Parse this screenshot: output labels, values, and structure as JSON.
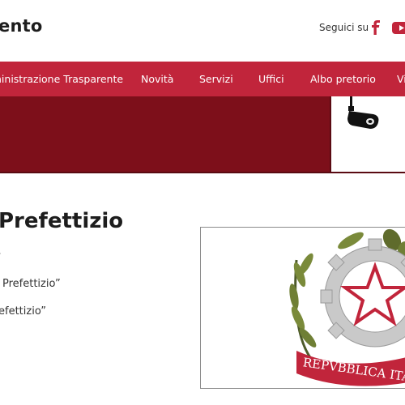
{
  "header": {
    "site_title": "ento",
    "social_label": "Seguici su",
    "icons": [
      "facebook-icon",
      "youtube-icon"
    ]
  },
  "nav": {
    "items": [
      "ninistrazione Trasparente",
      "Novità",
      "Servizi",
      "Uffici",
      "Albo pretorio",
      "Vi"
    ]
  },
  "banner": {
    "icon": "camera-icon"
  },
  "content": {
    "title": "Prefettizio",
    "dash": "-",
    "line1": "Prefettizio”",
    "line2": "efettizio”"
  },
  "emblem": {
    "ribbon_text": "REPVBBLICA ITA"
  },
  "colors": {
    "nav_bg": "#c1253b",
    "banner_bg": "#7d0f1a",
    "accent_red": "#c1253b"
  }
}
